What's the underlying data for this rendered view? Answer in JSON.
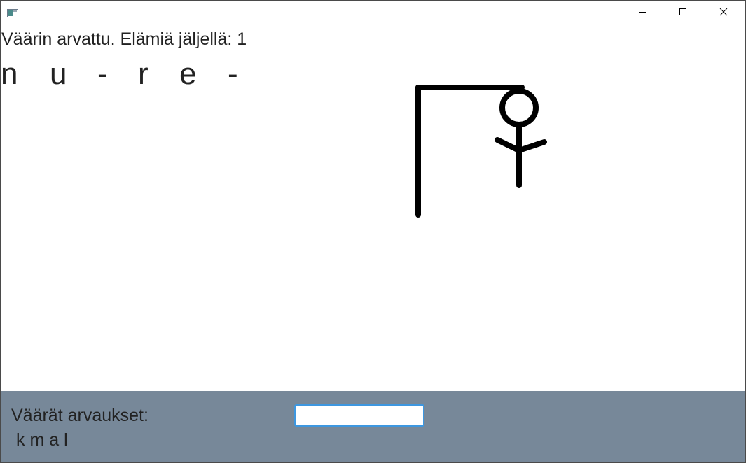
{
  "window": {
    "controls": {
      "minimize_icon": "minimize-icon",
      "maximize_icon": "maximize-icon",
      "close_icon": "close-icon"
    }
  },
  "game": {
    "status_text": "Väärin arvattu. Elämiä jäljellä: 1",
    "word": [
      "n",
      "u",
      "-",
      "r",
      "e",
      "-"
    ],
    "hangman": {
      "parts_drawn": [
        "gallows-post",
        "gallows-beam",
        "head",
        "body",
        "arms"
      ],
      "line_color": "#000000"
    }
  },
  "panel": {
    "background": "#778899",
    "wrong_label": "Väärät arvaukset:",
    "wrong_letters": "k m a l",
    "guess_input": {
      "value": "",
      "placeholder": ""
    }
  }
}
